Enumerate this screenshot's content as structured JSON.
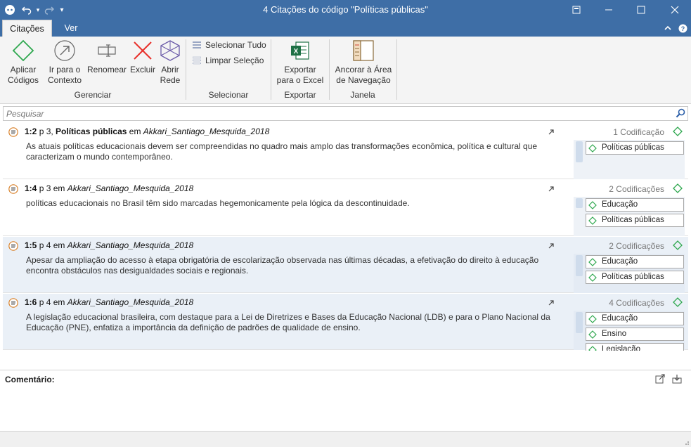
{
  "window": {
    "title": "4 Citações do código \"Políticas públicas\""
  },
  "tabs": [
    {
      "label": "Citações",
      "active": true
    },
    {
      "label": "Ver",
      "active": false
    }
  ],
  "ribbon": {
    "gerenciar": {
      "label": "Gerenciar",
      "aplicar": [
        "Aplicar",
        "Códigos"
      ],
      "ir": [
        "Ir para o",
        "Contexto"
      ],
      "renomear": "Renomear",
      "excluir": "Excluir",
      "abrir": [
        "Abrir",
        "Rede"
      ]
    },
    "selecionar": {
      "label": "Selecionar",
      "tudo": "Selecionar Tudo",
      "limpar": "Limpar Seleção"
    },
    "exportar": {
      "label": "Exportar",
      "excel": [
        "Exportar",
        "para o Excel"
      ]
    },
    "janela": {
      "label": "Janela",
      "ancorar": [
        "Ancorar à Área",
        "de Navegação"
      ]
    }
  },
  "search": {
    "placeholder": "Pesquisar"
  },
  "quotations": [
    {
      "id": "1:2",
      "page": "p 3,",
      "name": "Políticas públicas",
      "connector": "em",
      "document": "Akkari_Santiago_Mesquida_2018",
      "text": "As atuais políticas educacionais devem ser compreendidas no quadro mais  amplo das transformações econômica, política e cultural que caracterizam o  mundo contemporâneo.",
      "count": "1 Codificação",
      "codes": [
        "Políticas públicas"
      ]
    },
    {
      "id": "1:4",
      "page": "p 3",
      "name": "",
      "connector": "em",
      "document": "Akkari_Santiago_Mesquida_2018",
      "text": "políticas educacionais no Brasil têm sido marcadas hegemonicamente pela  lógica da descontinuidade.",
      "count": "2 Codificações",
      "codes": [
        "Educação",
        "Políticas públicas"
      ]
    },
    {
      "id": "1:5",
      "page": "p 4",
      "name": "",
      "connector": "em",
      "document": "Akkari_Santiago_Mesquida_2018",
      "text": "Apesar da ampliação do acesso à etapa obrigatória de escolarização observada  nas últimas décadas, a efetivação do direito à educação encontra obstáculos nas  desigualdades sociais e regionais.",
      "count": "2 Codificações",
      "codes": [
        "Educação",
        "Políticas públicas"
      ]
    },
    {
      "id": "1:6",
      "page": "p 4",
      "name": "",
      "connector": "em",
      "document": "Akkari_Santiago_Mesquida_2018",
      "text": "A legislação educacional brasileira, com destaque para a Lei de Diretrizes e  Bases da Educação Nacional (LDB) e para o Plano Nacional da Educação (PNE), enfatiza a importância da definição de padrões de qualidade de ensino.",
      "count": "4 Codificações",
      "codes": [
        "Educação",
        "Ensino",
        "Legislação"
      ]
    }
  ],
  "comment": {
    "label": "Comentário:"
  },
  "colors": {
    "titlebar": "#3e6ea6",
    "code_green": "#2fa84f",
    "selected_row": "#eaf0f7"
  }
}
